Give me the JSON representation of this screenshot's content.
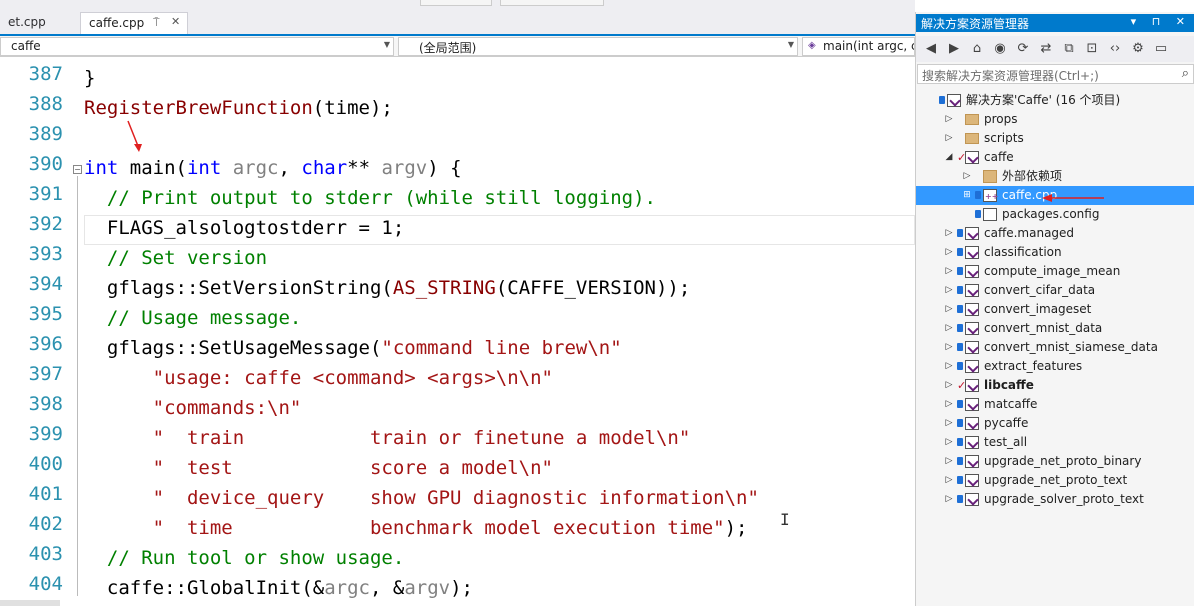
{
  "tabs": {
    "prev_label": "et.cpp",
    "active_label": "caffe.cpp",
    "pin_glyph": "⍑",
    "close_glyph": "✕"
  },
  "nav": {
    "project": "caffe",
    "scope": "(全局范围)",
    "member": "main(int argc, c"
  },
  "line_numbers": [
    "387",
    "388",
    "389",
    "390",
    "391",
    "392",
    "393",
    "394",
    "395",
    "396",
    "397",
    "398",
    "399",
    "400",
    "401",
    "402",
    "403",
    "404"
  ],
  "code_lines": [
    [
      {
        "t": "}",
        "c": "tx"
      }
    ],
    [
      {
        "t": "RegisterBrewFunction",
        "c": "fn"
      },
      {
        "t": "(time);",
        "c": "tx"
      }
    ],
    [],
    [
      {
        "t": "int ",
        "c": "kw"
      },
      {
        "t": "main(",
        "c": "tx"
      },
      {
        "t": "int ",
        "c": "kw"
      },
      {
        "t": "argc",
        "c": "pm"
      },
      {
        "t": ", ",
        "c": "tx"
      },
      {
        "t": "char",
        "c": "kw"
      },
      {
        "t": "** ",
        "c": "tx"
      },
      {
        "t": "argv",
        "c": "pm"
      },
      {
        "t": ") {",
        "c": "tx"
      }
    ],
    [
      {
        "t": "  // Print output to stderr (while still logging).",
        "c": "cm"
      }
    ],
    [
      {
        "t": "  FLAGS_alsologtostderr = 1;",
        "c": "tx"
      }
    ],
    [
      {
        "t": "  // Set version",
        "c": "cm"
      }
    ],
    [
      {
        "t": "  gflags::SetVersionString(",
        "c": "tx"
      },
      {
        "t": "AS_STRING",
        "c": "fn"
      },
      {
        "t": "(CAFFE_VERSION));",
        "c": "tx"
      }
    ],
    [
      {
        "t": "  // Usage message.",
        "c": "cm"
      }
    ],
    [
      {
        "t": "  gflags::SetUsageMessage(",
        "c": "tx"
      },
      {
        "t": "\"command line brew\\n\"",
        "c": "st"
      }
    ],
    [
      {
        "t": "      \"usage: caffe <command> <args>\\n\\n\"",
        "c": "st"
      }
    ],
    [
      {
        "t": "      \"commands:\\n\"",
        "c": "st"
      }
    ],
    [
      {
        "t": "      \"  train           train or finetune a model\\n\"",
        "c": "st"
      }
    ],
    [
      {
        "t": "      \"  test            score a model\\n\"",
        "c": "st"
      }
    ],
    [
      {
        "t": "      \"  device_query    show GPU diagnostic information\\n\"",
        "c": "st"
      }
    ],
    [
      {
        "t": "      \"  time            benchmark model execution time\"",
        "c": "st"
      },
      {
        "t": ");",
        "c": "tx"
      }
    ],
    [
      {
        "t": "  // Run tool or show usage.",
        "c": "cm"
      }
    ],
    [
      {
        "t": "  caffe::GlobalInit(&",
        "c": "tx"
      },
      {
        "t": "argc",
        "c": "pm"
      },
      {
        "t": ", &",
        "c": "tx"
      },
      {
        "t": "argv",
        "c": "pm"
      },
      {
        "t": ");",
        "c": "tx"
      }
    ]
  ],
  "explorer": {
    "title": "解决方案资源管理器",
    "title_controls": "▾ ⊓ ✕",
    "search_placeholder": "搜索解决方案资源管理器(Ctrl+;)",
    "search_icon": "magnifier-icon",
    "toolbar_icons": [
      "back-icon",
      "forward-icon",
      "home-icon",
      "globe-icon",
      "history-icon",
      "sync-icon",
      "collapse-all-icon",
      "show-all-files-icon",
      "code-view-icon",
      "properties-icon",
      "preview-icon"
    ],
    "tree": [
      {
        "label": "解决方案'Caffe' (16 个项目)",
        "indent": 0,
        "expander": "",
        "icon": "solution",
        "lock": true,
        "check": false,
        "bold": false,
        "selected": false
      },
      {
        "label": "props",
        "indent": 1,
        "expander": "▷",
        "icon": "folder",
        "lock": false,
        "check": false,
        "bold": false,
        "selected": false
      },
      {
        "label": "scripts",
        "indent": 1,
        "expander": "▷",
        "icon": "folder",
        "lock": false,
        "check": false,
        "bold": false,
        "selected": false
      },
      {
        "label": "caffe",
        "indent": 1,
        "expander": "◢",
        "icon": "proj",
        "lock": false,
        "check": true,
        "bold": false,
        "selected": false
      },
      {
        "label": "外部依赖项",
        "indent": 2,
        "expander": "▷",
        "icon": "deps",
        "lock": false,
        "check": false,
        "bold": false,
        "selected": false
      },
      {
        "label": "caffe.cpp",
        "indent": 2,
        "expander": "⊞",
        "icon": "cpp",
        "lock": true,
        "check": false,
        "bold": false,
        "selected": true
      },
      {
        "label": "packages.config",
        "indent": 2,
        "expander": "",
        "icon": "cfg",
        "lock": true,
        "check": false,
        "bold": false,
        "selected": false
      },
      {
        "label": "caffe.managed",
        "indent": 1,
        "expander": "▷",
        "icon": "proj",
        "lock": true,
        "check": false,
        "bold": false,
        "selected": false
      },
      {
        "label": "classification",
        "indent": 1,
        "expander": "▷",
        "icon": "proj",
        "lock": true,
        "check": false,
        "bold": false,
        "selected": false
      },
      {
        "label": "compute_image_mean",
        "indent": 1,
        "expander": "▷",
        "icon": "proj",
        "lock": true,
        "check": false,
        "bold": false,
        "selected": false
      },
      {
        "label": "convert_cifar_data",
        "indent": 1,
        "expander": "▷",
        "icon": "proj",
        "lock": true,
        "check": false,
        "bold": false,
        "selected": false
      },
      {
        "label": "convert_imageset",
        "indent": 1,
        "expander": "▷",
        "icon": "proj",
        "lock": true,
        "check": false,
        "bold": false,
        "selected": false
      },
      {
        "label": "convert_mnist_data",
        "indent": 1,
        "expander": "▷",
        "icon": "proj",
        "lock": true,
        "check": false,
        "bold": false,
        "selected": false
      },
      {
        "label": "convert_mnist_siamese_data",
        "indent": 1,
        "expander": "▷",
        "icon": "proj",
        "lock": true,
        "check": false,
        "bold": false,
        "selected": false
      },
      {
        "label": "extract_features",
        "indent": 1,
        "expander": "▷",
        "icon": "proj",
        "lock": true,
        "check": false,
        "bold": false,
        "selected": false
      },
      {
        "label": "libcaffe",
        "indent": 1,
        "expander": "▷",
        "icon": "proj",
        "lock": false,
        "check": true,
        "bold": true,
        "selected": false
      },
      {
        "label": "matcaffe",
        "indent": 1,
        "expander": "▷",
        "icon": "proj",
        "lock": true,
        "check": false,
        "bold": false,
        "selected": false
      },
      {
        "label": "pycaffe",
        "indent": 1,
        "expander": "▷",
        "icon": "proj",
        "lock": true,
        "check": false,
        "bold": false,
        "selected": false
      },
      {
        "label": "test_all",
        "indent": 1,
        "expander": "▷",
        "icon": "proj",
        "lock": true,
        "check": false,
        "bold": false,
        "selected": false
      },
      {
        "label": "upgrade_net_proto_binary",
        "indent": 1,
        "expander": "▷",
        "icon": "proj",
        "lock": true,
        "check": false,
        "bold": false,
        "selected": false
      },
      {
        "label": "upgrade_net_proto_text",
        "indent": 1,
        "expander": "▷",
        "icon": "proj",
        "lock": true,
        "check": false,
        "bold": false,
        "selected": false
      },
      {
        "label": "upgrade_solver_proto_text",
        "indent": 1,
        "expander": "▷",
        "icon": "proj",
        "lock": true,
        "check": false,
        "bold": false,
        "selected": false
      }
    ]
  },
  "colors": {
    "accent": "#007acc",
    "selection": "#3399ff",
    "keyword": "#0000ff",
    "string": "#a31515",
    "comment": "#008000",
    "line_number": "#2b91af",
    "annotation_arrow": "#e02020"
  }
}
